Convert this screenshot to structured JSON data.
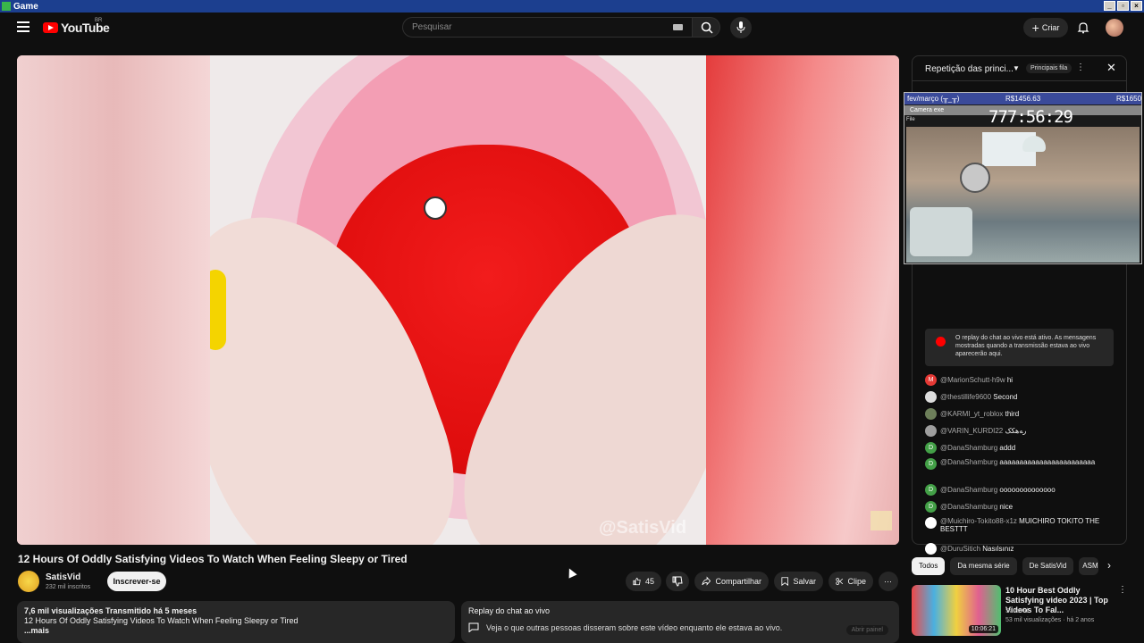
{
  "titlebar": {
    "title": "Game"
  },
  "masthead": {
    "logo_text": "YouTube",
    "country_code": "BR",
    "search_placeholder": "Pesquisar",
    "create_label": "Criar"
  },
  "video": {
    "watermark": "@SatisVid",
    "title": "12 Hours Of Oddly Satisfying Videos To Watch When Feeling Sleepy or Tired"
  },
  "channel": {
    "name": "SatisVid",
    "subscribers": "232 mil inscritos",
    "subscribe_label": "Inscrever-se"
  },
  "actions": {
    "like_count": "45",
    "share_label": "Compartilhar",
    "save_label": "Salvar",
    "clip_label": "Clipe"
  },
  "description": {
    "meta": "7,6 mil visualizações  Transmitido há 5 meses",
    "text": "12 Hours Of Oddly Satisfying Videos To Watch When Feeling Sleepy or Tired",
    "more": "...mais"
  },
  "replay": {
    "title": "Replay do chat ao vivo",
    "subtitle": "Veja o que outras pessoas disseram sobre este vídeo enquanto ele estava ao vivo.",
    "button": "Abrir painel"
  },
  "chat": {
    "header_title": "Repetição das princi...",
    "header_tag": "Principais fila",
    "notice": "O replay do chat ao vivo está ativo. As mensagens mostradas quando a transmissão estava ao vivo aparecerão aqui.",
    "messages": [
      {
        "initial": "M",
        "color": "#e53935",
        "user": "@MarionSchutt-h9w",
        "text": "hi"
      },
      {
        "initial": "",
        "color": "#dddddd",
        "user": "@thestillife9600",
        "text": "Second"
      },
      {
        "initial": "",
        "color": "#6d7f5a",
        "user": "@KARMI_yt_roblox",
        "text": "third"
      },
      {
        "initial": "",
        "color": "#9e9e9e",
        "user": "@VARIN_KURDI22",
        "text": "ﺭﻪﻫﮑﮏ"
      },
      {
        "initial": "D",
        "color": "#43a047",
        "user": "@DanaShamburg",
        "text": "addd"
      },
      {
        "initial": "D",
        "color": "#43a047",
        "user": "@DanaShamburg",
        "text": "aaaaaaaaaaaaaaaaaaaaaaaa"
      },
      {
        "initial": "D",
        "color": "#43a047",
        "user": "@DanaShamburg",
        "text": "oooooooooooooo"
      },
      {
        "initial": "D",
        "color": "#43a047",
        "user": "@DanaShamburg",
        "text": "nice"
      },
      {
        "initial": "",
        "color": "#ffffff",
        "user": "@Muichiro-Tokito88-x1z",
        "text": "MUICHIRO TOKITO THE BESTTT"
      },
      {
        "initial": "",
        "color": "#ffffff",
        "user": "@DuruSitich",
        "text": "Nasılsınız"
      }
    ]
  },
  "overlay": {
    "label": "fev/março (╥_╥)",
    "amount1": "R$1456.63",
    "amount2": "R$1650",
    "camera": "Camera exe",
    "file": "File",
    "timer": "777:56:29"
  },
  "tabs": [
    "Todos",
    "Da mesma série",
    "De SatisVid",
    "ASM"
  ],
  "recommendation": {
    "title": "10 Hour Best Oddly Satisfying video 2023 | Top Videos To Fal...",
    "channel": "SatisVid",
    "meta": "53 mil visualizações · há 2 anos",
    "duration": "10:06:21"
  }
}
